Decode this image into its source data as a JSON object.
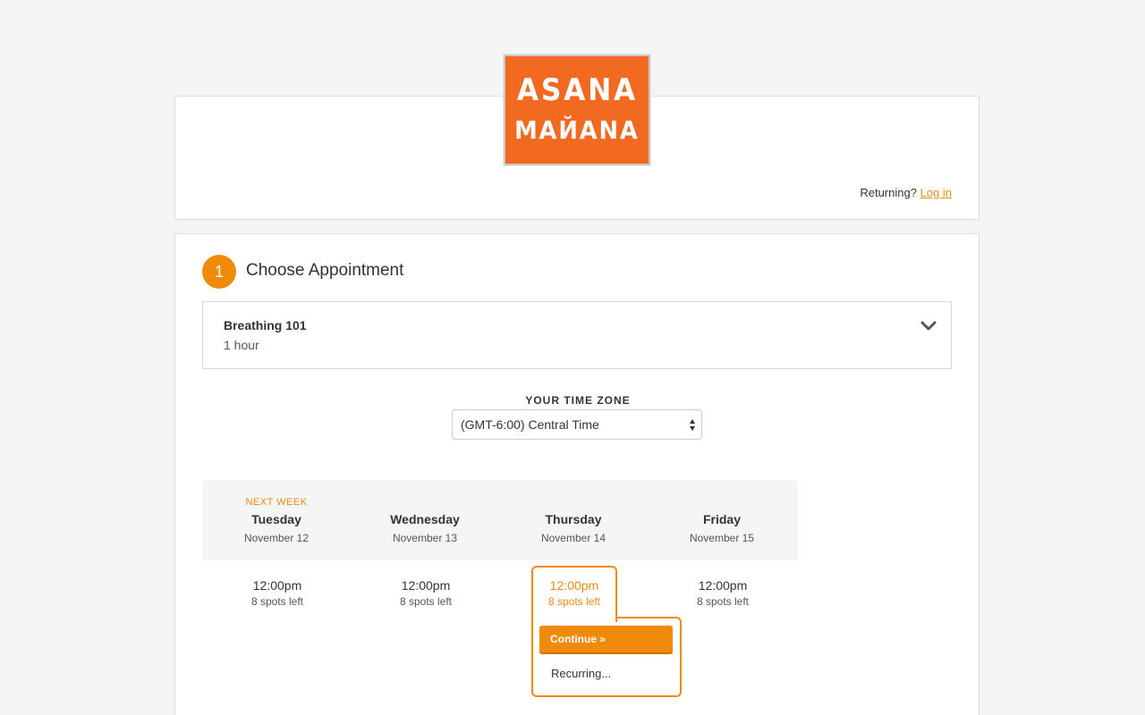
{
  "brand": {
    "logo_line1": "ASANA",
    "logo_line2": "МАЙАNA",
    "logo_color": "#f26922"
  },
  "header": {
    "returning_text": "Returning?",
    "login_link": "Log in"
  },
  "step": {
    "number": "1",
    "title": "Choose Appointment"
  },
  "appointment": {
    "name": "Breathing 101",
    "duration": "1 hour",
    "icon": "chevron-down-icon"
  },
  "timezone": {
    "label": "YOUR TIME ZONE",
    "value": "(GMT-6:00) Central Time"
  },
  "days": [
    {
      "tag": "NEXT WEEK",
      "name": "Tuesday",
      "date": "November 12",
      "slot_time": "12:00pm",
      "slot_spots": "8 spots left"
    },
    {
      "tag": "",
      "name": "Wednesday",
      "date": "November 13",
      "slot_time": "12:00pm",
      "slot_spots": "8 spots left"
    },
    {
      "tag": "",
      "name": "Thursday",
      "date": "November 14",
      "slot_time": "12:00pm",
      "slot_spots": "8 spots left"
    },
    {
      "tag": "",
      "name": "Friday",
      "date": "November 15",
      "slot_time": "12:00pm",
      "slot_spots": "8 spots left"
    }
  ],
  "popup": {
    "continue_label": "Continue »",
    "recurring_label": "Recurring..."
  },
  "colors": {
    "accent": "#f08a0b",
    "link": "#ef8a13",
    "background": "#f5f5f5"
  }
}
